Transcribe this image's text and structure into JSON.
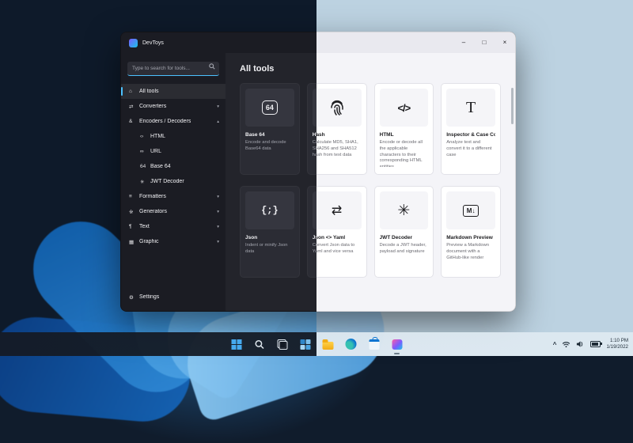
{
  "window": {
    "title": "DevToys",
    "titlebar": {
      "minimize": "–",
      "maximize": "□",
      "close": "×"
    },
    "search": {
      "placeholder": "Type to search for tools..."
    },
    "sidebar": {
      "items": [
        {
          "label": "All tools",
          "glyph": "⌂",
          "selected": true
        },
        {
          "label": "Converters",
          "glyph": "⇄",
          "chevron": "▾"
        },
        {
          "label": "Encoders / Decoders",
          "glyph": "&",
          "chevron": "▴"
        },
        {
          "label": "HTML",
          "glyph": "‹›",
          "sub": true
        },
        {
          "label": "URL",
          "glyph": "∞",
          "sub": true
        },
        {
          "label": "Base 64",
          "glyph": "64",
          "sub": true
        },
        {
          "label": "JWT Decoder",
          "glyph": "✳",
          "sub": true
        },
        {
          "label": "Formatters",
          "glyph": "≡",
          "chevron": "▾"
        },
        {
          "label": "Generators",
          "glyph": "※",
          "chevron": "▾"
        },
        {
          "label": "Text",
          "glyph": "¶",
          "chevron": "▾"
        },
        {
          "label": "Graphic",
          "glyph": "▦",
          "chevron": "▾"
        }
      ],
      "settings": {
        "label": "Settings",
        "glyph": "⚙"
      }
    },
    "main": {
      "heading": "All tools",
      "cards": [
        {
          "title": "Base 64",
          "icon": "base64-icon",
          "icon_glyph": "64",
          "description": "Encode and decode Base64 data"
        },
        {
          "title": "Hash",
          "icon": "fingerprint-icon",
          "icon_glyph": "",
          "description": "Calculate MD5, SHA1, SHA256 and SHA512 hash from text data"
        },
        {
          "title": "HTML",
          "icon": "code-icon",
          "icon_glyph": "</>",
          "description": "Encode or decode all the applicable characters to their corresponding HTML entities"
        },
        {
          "title": "Inspector & Case Converter",
          "icon": "text-case-icon",
          "icon_glyph": "T",
          "description": "Analyze text and convert it to a different case"
        },
        {
          "title": "Json",
          "icon": "braces-icon",
          "icon_glyph": "{;}",
          "description": "Indent or minify Json data"
        },
        {
          "title": "Json <> Yaml",
          "icon": "swap-icon",
          "icon_glyph": "⇄",
          "description": "Convert Json data to Yaml and vice versa"
        },
        {
          "title": "JWT Decoder",
          "icon": "burst-icon",
          "icon_glyph": "✳",
          "description": "Decode a JWT header, payload and signature"
        },
        {
          "title": "Markdown Preview",
          "icon": "markdown-icon",
          "icon_glyph": "M↓",
          "description": "Preview a Markdown document with a GitHub-like render"
        }
      ]
    }
  },
  "taskbar": {
    "icons": [
      "start-icon",
      "search-icon",
      "task-view-icon",
      "widgets-icon",
      "file-explorer-icon",
      "edge-icon",
      "store-icon",
      "devtoys-icon"
    ],
    "tray": {
      "hidden_icons_chevron": "^",
      "time": "1:10 PM",
      "date": "1/19/2022"
    }
  },
  "colors": {
    "accent_dark": "#4cc2ff",
    "accent_light": "#0067c0"
  }
}
